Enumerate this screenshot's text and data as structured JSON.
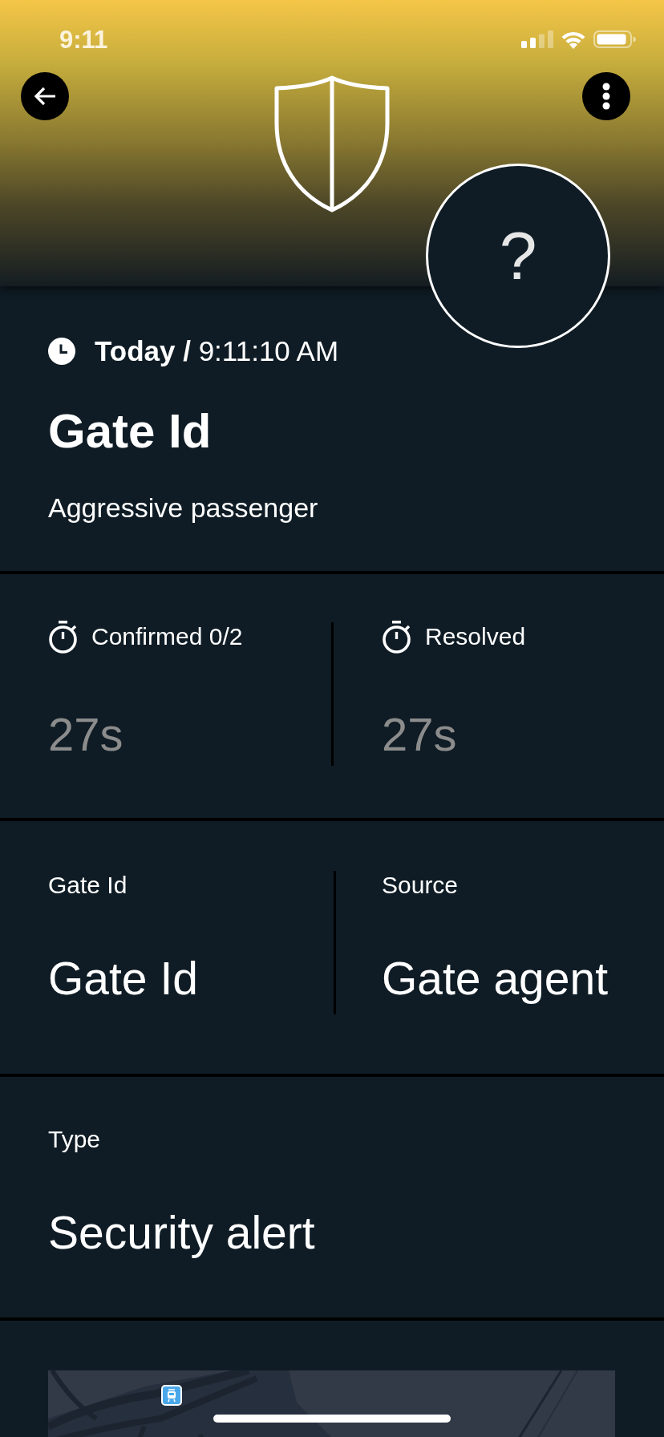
{
  "status_bar": {
    "time": "9:11"
  },
  "header": {
    "status_symbol": "?"
  },
  "event": {
    "timestamp": "**Today /** 9:11:10 AM",
    "title": "Gate Id",
    "description": "Aggressive passenger"
  },
  "timers": [
    {
      "label": "Confirmed 0/2",
      "value": "27s"
    },
    {
      "label": "Resolved",
      "value": "27s"
    }
  ],
  "details": [
    {
      "label": "Gate Id",
      "value": "Gate Id"
    },
    {
      "label": "Source",
      "value": "Gate agent"
    }
  ],
  "type": {
    "label": "Type",
    "value": "Security alert"
  }
}
